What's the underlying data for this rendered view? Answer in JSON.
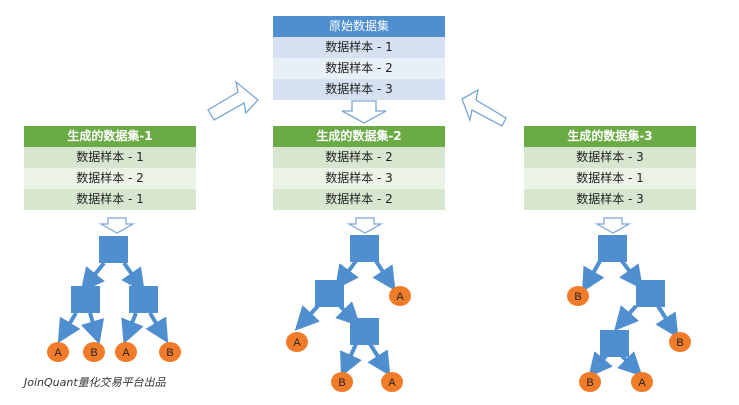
{
  "original": {
    "title": "原始数据集",
    "rows": [
      "数据样本 - 1",
      "数据样本 - 2",
      "数据样本 - 3"
    ]
  },
  "generated": [
    {
      "title": "生成的数据集-1",
      "rows": [
        "数据样本 - 1",
        "数据样本 - 2",
        "数据样本 - 1"
      ]
    },
    {
      "title": "生成的数据集-2",
      "rows": [
        "数据样本 - 2",
        "数据样本 - 3",
        "数据样本 - 2"
      ]
    },
    {
      "title": "生成的数据集-3",
      "rows": [
        "数据样本 - 3",
        "数据样本 - 1",
        "数据样本 - 3"
      ]
    }
  ],
  "trees": [
    {
      "leaves": [
        "A",
        "B",
        "A",
        "B"
      ]
    },
    {
      "leaves": [
        "A",
        "A",
        "B",
        "A"
      ]
    },
    {
      "leaves": [
        "B",
        "B",
        "B",
        "A"
      ]
    }
  ],
  "caption": "JoinQuant量化交易平台出品",
  "colors": {
    "blue_header": "#4f8fd0",
    "green_header": "#6aab46",
    "node": "#4f8fd0",
    "leaf": "#f07c2a"
  }
}
